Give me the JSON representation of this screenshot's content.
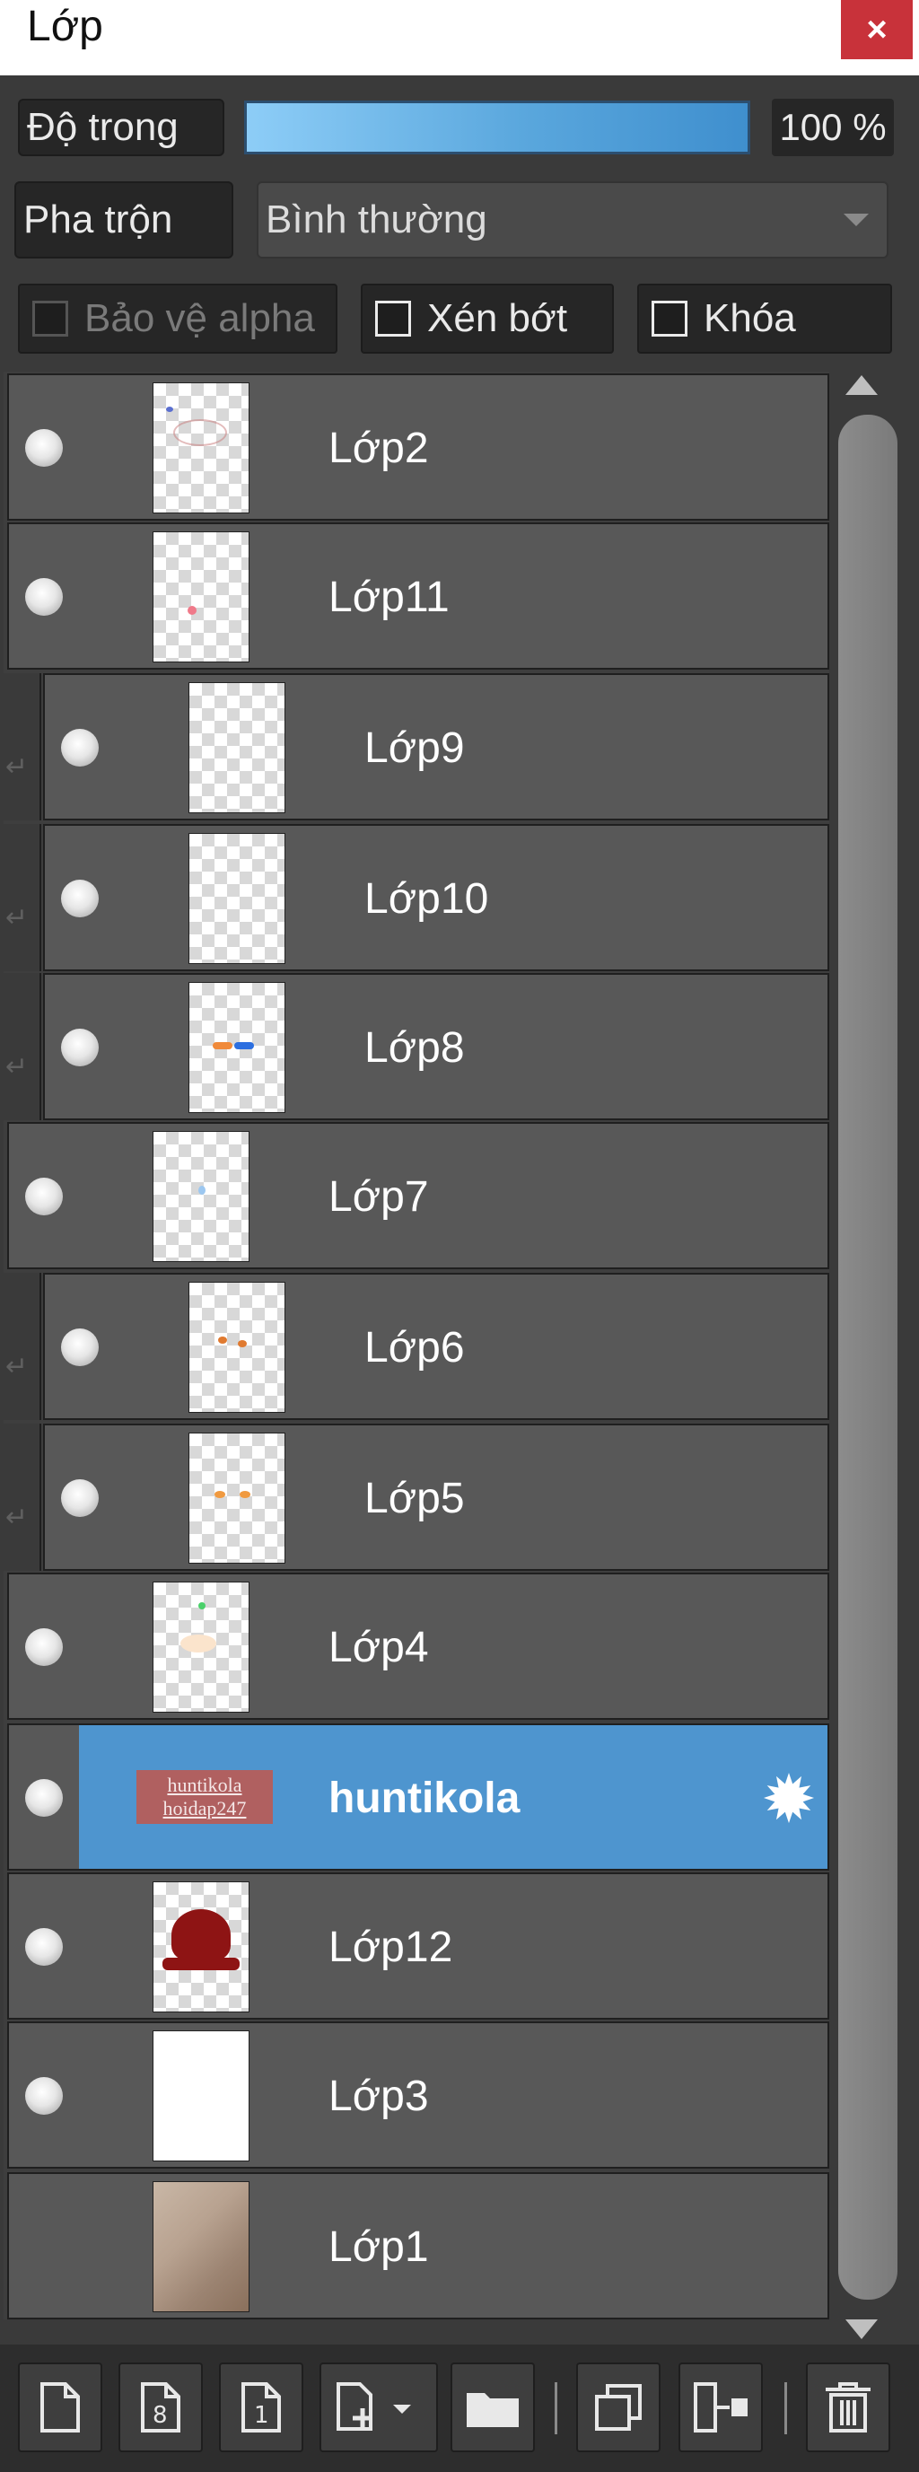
{
  "window": {
    "title": "Lớp",
    "close_label": "×"
  },
  "opacity": {
    "label": "Độ trong",
    "value": 100,
    "value_text": "100 %"
  },
  "blend": {
    "label": "Pha trộn",
    "selected": "Bình thường"
  },
  "checkboxes": {
    "protect_alpha": {
      "label": "Bảo vệ alpha",
      "checked": false,
      "enabled": false
    },
    "clipping": {
      "label": "Xén bớt",
      "checked": false,
      "enabled": true
    },
    "lock": {
      "label": "Khóa",
      "checked": false,
      "enabled": true
    }
  },
  "layers": [
    {
      "name": "Lớp2",
      "visible": true,
      "clipped": false,
      "selected": false
    },
    {
      "name": "Lớp11",
      "visible": true,
      "clipped": false,
      "selected": false
    },
    {
      "name": "Lớp9",
      "visible": true,
      "clipped": true,
      "selected": false
    },
    {
      "name": "Lớp10",
      "visible": true,
      "clipped": true,
      "selected": false
    },
    {
      "name": "Lớp8",
      "visible": true,
      "clipped": true,
      "selected": false
    },
    {
      "name": "Lớp7",
      "visible": true,
      "clipped": false,
      "selected": false
    },
    {
      "name": "Lớp6",
      "visible": true,
      "clipped": true,
      "selected": false
    },
    {
      "name": "Lớp5",
      "visible": true,
      "clipped": true,
      "selected": false
    },
    {
      "name": "Lớp4",
      "visible": true,
      "clipped": false,
      "selected": false
    },
    {
      "name": "huntikola",
      "visible": true,
      "clipped": false,
      "selected": true,
      "thumb_text": [
        "huntikola",
        "hoidap247"
      ]
    },
    {
      "name": "Lớp12",
      "visible": true,
      "clipped": false,
      "selected": false
    },
    {
      "name": "Lớp3",
      "visible": true,
      "clipped": false,
      "selected": false
    },
    {
      "name": "Lớp1",
      "visible": false,
      "clipped": false,
      "selected": false
    }
  ],
  "toolbar": {
    "buttons": [
      {
        "icon": "new-layer-icon"
      },
      {
        "icon": "new-8bit-layer-icon",
        "glyph": "8"
      },
      {
        "icon": "new-1bit-layer-icon",
        "glyph": "1"
      },
      {
        "icon": "add-layer-menu-icon"
      },
      {
        "icon": "folder-icon"
      },
      {
        "icon": "duplicate-layer-icon"
      },
      {
        "icon": "merge-down-icon"
      },
      {
        "icon": "delete-layer-icon"
      }
    ]
  },
  "colors": {
    "selected_row": "#4e95cf",
    "close_button": "#c8323a",
    "opacity_fill": "#5aa7dd"
  }
}
